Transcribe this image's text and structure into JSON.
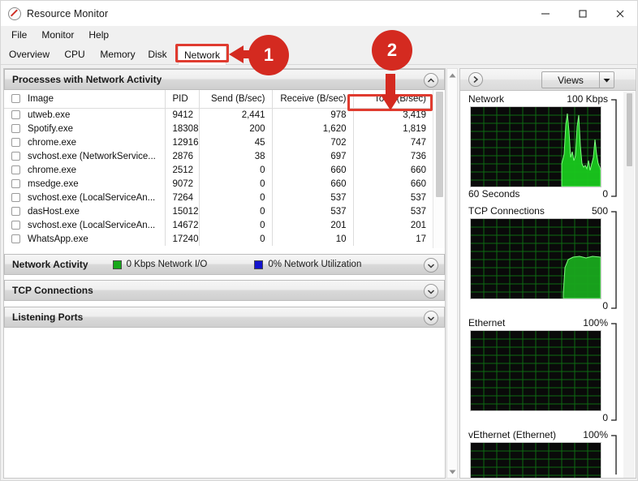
{
  "window": {
    "title": "Resource Monitor",
    "icon": "resource-monitor-icon",
    "minimize": "–",
    "maximize": "□",
    "close": "✕"
  },
  "menu": {
    "items": [
      {
        "label": "File"
      },
      {
        "label": "Monitor"
      },
      {
        "label": "Help"
      }
    ]
  },
  "tabs": {
    "items": [
      {
        "label": "Overview",
        "selected": false
      },
      {
        "label": "CPU",
        "selected": false
      },
      {
        "label": "Memory",
        "selected": false
      },
      {
        "label": "Disk",
        "selected": false
      },
      {
        "label": "Network",
        "selected": true
      }
    ]
  },
  "processes_section": {
    "title": "Processes with Network Activity",
    "collapse_icon": "chevron-up-icon",
    "columns": [
      "Image",
      "PID",
      "Send (B/sec)",
      "Receive (B/sec)",
      "Total (B/sec)"
    ],
    "rows": [
      {
        "image": "utweb.exe",
        "pid": "9412",
        "send": "2,441",
        "receive": "978",
        "total": "3,419"
      },
      {
        "image": "Spotify.exe",
        "pid": "18308",
        "send": "200",
        "receive": "1,620",
        "total": "1,819"
      },
      {
        "image": "chrome.exe",
        "pid": "12916",
        "send": "45",
        "receive": "702",
        "total": "747"
      },
      {
        "image": "svchost.exe (NetworkService...",
        "pid": "2876",
        "send": "38",
        "receive": "697",
        "total": "736"
      },
      {
        "image": "chrome.exe",
        "pid": "2512",
        "send": "0",
        "receive": "660",
        "total": "660"
      },
      {
        "image": "msedge.exe",
        "pid": "9072",
        "send": "0",
        "receive": "660",
        "total": "660"
      },
      {
        "image": "svchost.exe (LocalServiceAn...",
        "pid": "7264",
        "send": "0",
        "receive": "537",
        "total": "537"
      },
      {
        "image": "dasHost.exe",
        "pid": "15012",
        "send": "0",
        "receive": "537",
        "total": "537"
      },
      {
        "image": "svchost.exe (LocalServiceAn...",
        "pid": "14672",
        "send": "0",
        "receive": "201",
        "total": "201"
      },
      {
        "image": "WhatsApp.exe",
        "pid": "17240",
        "send": "0",
        "receive": "10",
        "total": "17"
      }
    ]
  },
  "collapsed_sections": [
    {
      "title": "Network Activity",
      "legend": [
        {
          "label": "0 Kbps Network I/O",
          "color": "#17a81a"
        },
        {
          "label": "0% Network Utilization",
          "color": "#1414cd"
        }
      ],
      "expand_icon": "chevron-down-icon"
    },
    {
      "title": "TCP Connections",
      "legend": [],
      "expand_icon": "chevron-down-icon"
    },
    {
      "title": "Listening Ports",
      "legend": [],
      "expand_icon": "chevron-down-icon"
    }
  ],
  "right_panel": {
    "expand_icon": "chevron-right-icon",
    "views_label": "Views",
    "views_dropdown_icon": "caret-down-icon",
    "graphs": [
      {
        "name": "Network",
        "max": "100 Kbps",
        "min": "0",
        "bottom_left": "60 Seconds",
        "series": "network-throughput"
      },
      {
        "name": "TCP Connections",
        "max": "500",
        "min": "0",
        "bottom_left": "",
        "series": "tcp-connections"
      },
      {
        "name": "Ethernet",
        "max": "100%",
        "min": "0",
        "bottom_left": "",
        "series": "ethernet-utilization"
      },
      {
        "name": "vEthernet (Ethernet)",
        "max": "100%",
        "min": "",
        "bottom_left": "",
        "series": "vethernet-utilization"
      }
    ]
  },
  "annotations": {
    "badges": [
      {
        "number": "1"
      },
      {
        "number": "2"
      }
    ],
    "highlight_color": "#e03b2f"
  }
}
